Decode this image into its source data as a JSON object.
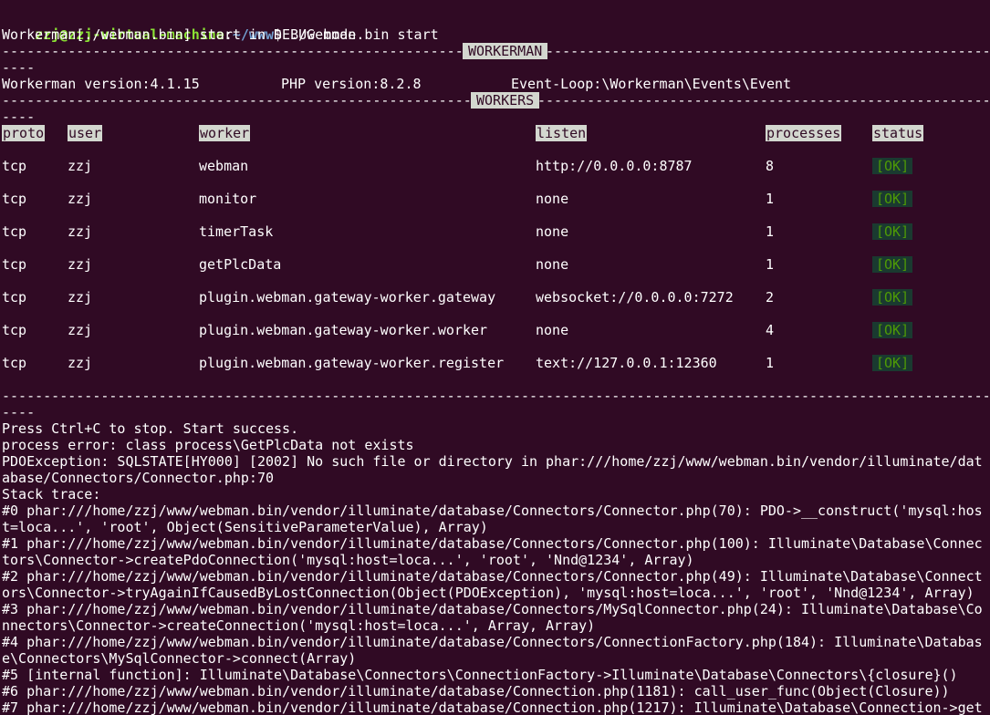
{
  "prompt": {
    "user_host": "zzj@zzj-virtual-machine",
    "colon": ":",
    "path": "~/www",
    "symbol": "$",
    "command": " ./webman.bin start"
  },
  "start_line": "Workerman[./webman.bin] start in DEBUG mode",
  "section_workerman": "WORKERMAN",
  "section_workers": "WORKERS",
  "dash_tail": "----",
  "version_info": {
    "workerman": "Workerman version:4.1.15",
    "php": "PHP version:8.2.8",
    "event_loop": "Event-Loop:\\Workerman\\Events\\Event"
  },
  "table": {
    "headers": [
      "proto",
      "user",
      "worker",
      "listen",
      "processes",
      "status"
    ],
    "rows": [
      [
        "tcp",
        "zzj",
        "webman",
        "http://0.0.0.0:8787",
        "8",
        "[OK]"
      ],
      [
        "tcp",
        "zzj",
        "monitor",
        "none",
        "1",
        "[OK]"
      ],
      [
        "tcp",
        "zzj",
        "timerTask",
        "none",
        "1",
        "[OK]"
      ],
      [
        "tcp",
        "zzj",
        "getPlcData",
        "none",
        "1",
        "[OK]"
      ],
      [
        "tcp",
        "zzj",
        "plugin.webman.gateway-worker.gateway",
        "websocket://0.0.0.0:7272",
        "2",
        "[OK]"
      ],
      [
        "tcp",
        "zzj",
        "plugin.webman.gateway-worker.worker",
        "none",
        "4",
        "[OK]"
      ],
      [
        "tcp",
        "zzj",
        "plugin.webman.gateway-worker.register",
        "text://127.0.0.1:12360",
        "1",
        "[OK]"
      ]
    ]
  },
  "output": [
    "Press Ctrl+C to stop. Start success.",
    "process error: class process\\GetPlcData not exists",
    "PDOException: SQLSTATE[HY000] [2002] No such file or directory in phar:///home/zzj/www/webman.bin/vendor/illuminate/dat",
    "abase/Connectors/Connector.php:70",
    "Stack trace:",
    "#0 phar:///home/zzj/www/webman.bin/vendor/illuminate/database/Connectors/Connector.php(70): PDO->__construct('mysql:hos",
    "t=loca...', 'root', Object(SensitiveParameterValue), Array)",
    "#1 phar:///home/zzj/www/webman.bin/vendor/illuminate/database/Connectors/Connector.php(100): Illuminate\\Database\\Connec",
    "tors\\Connector->createPdoConnection('mysql:host=loca...', 'root', 'Nnd@1234', Array)",
    "#2 phar:///home/zzj/www/webman.bin/vendor/illuminate/database/Connectors/Connector.php(49): Illuminate\\Database\\Connect",
    "ors\\Connector->tryAgainIfCausedByLostConnection(Object(PDOException), 'mysql:host=loca...', 'root', 'Nnd@1234', Array)",
    "#3 phar:///home/zzj/www/webman.bin/vendor/illuminate/database/Connectors/MySqlConnector.php(24): Illuminate\\Database\\Co",
    "nnectors\\Connector->createConnection('mysql:host=loca...', Array, Array)",
    "#4 phar:///home/zzj/www/webman.bin/vendor/illuminate/database/Connectors/ConnectionFactory.php(184): Illuminate\\Databas",
    "e\\Connectors\\MySqlConnector->connect(Array)",
    "#5 [internal function]: Illuminate\\Database\\Connectors\\ConnectionFactory->Illuminate\\Database\\Connectors\\{closure}()",
    "#6 phar:///home/zzj/www/webman.bin/vendor/illuminate/database/Connection.php(1181): call_user_func(Object(Closure))",
    "#7 phar:///home/zzj/www/webman.bin/vendor/illuminate/database/Connection.php(1217): Illuminate\\Database\\Connection->get"
  ]
}
